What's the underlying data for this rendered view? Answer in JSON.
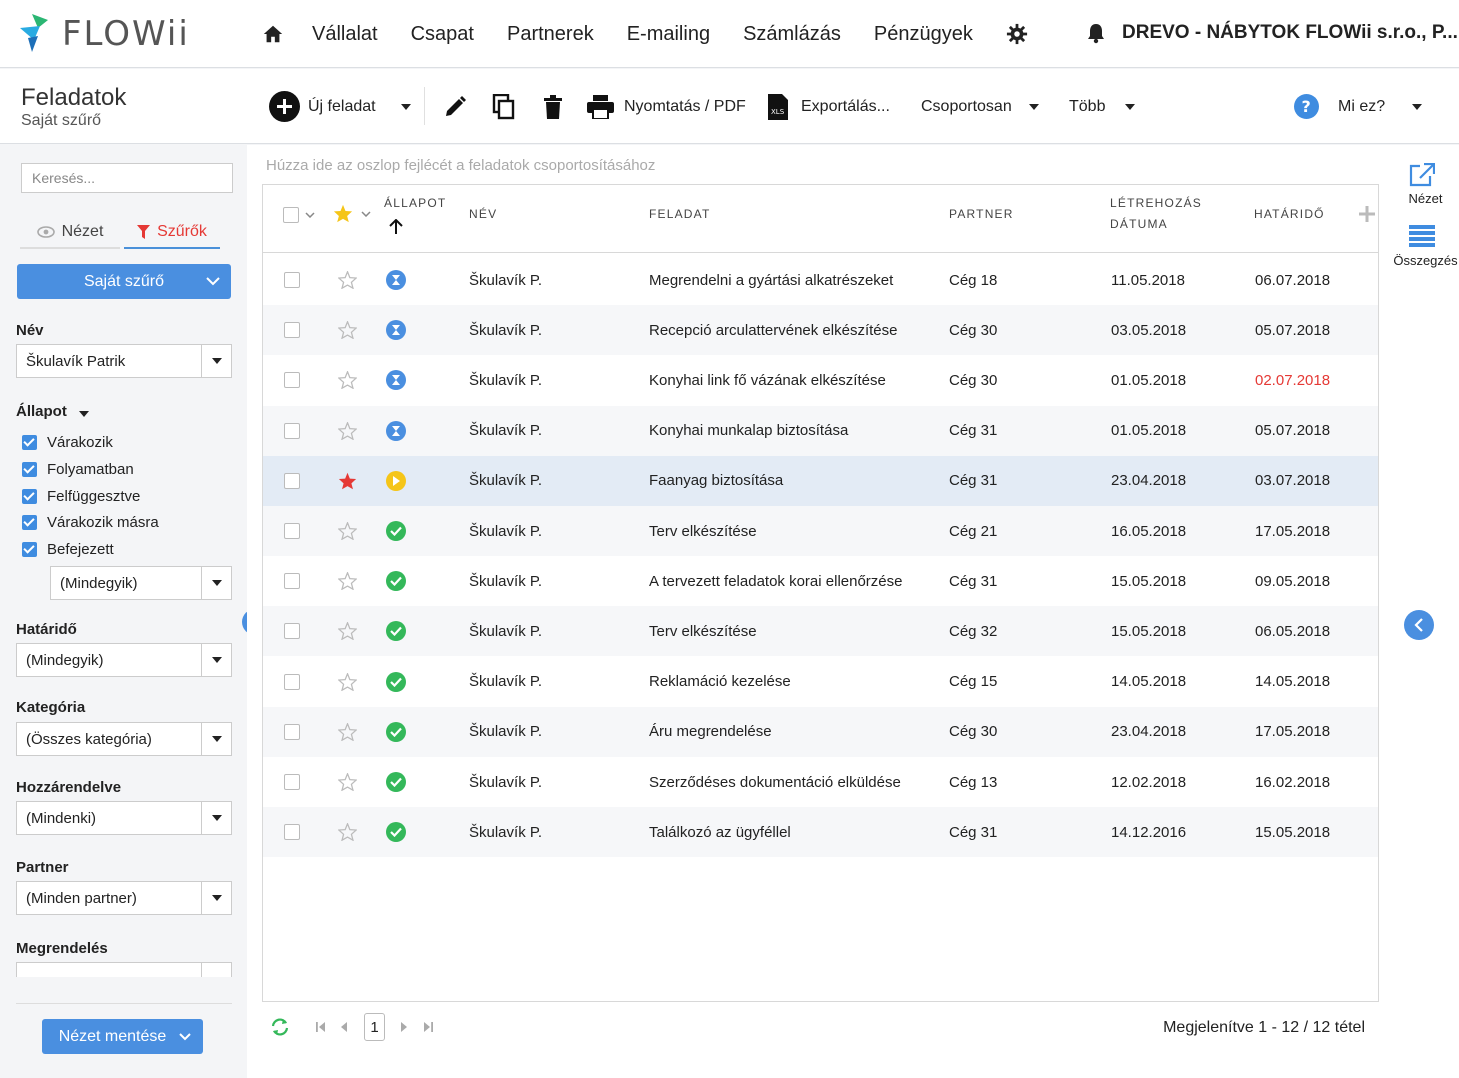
{
  "brand": {
    "logo_text": "FLOWii"
  },
  "nav": {
    "items": [
      "Vállalat",
      "Csapat",
      "Partnerek",
      "E-mailing",
      "Számlázás",
      "Pénzügyek"
    ],
    "company": "DREVO - NÁBYTOK FLOWii s.r.o., P..."
  },
  "toolbar": {
    "title": "Feladatok",
    "subtitle": "Saját szűrő",
    "new_task": "Új feladat",
    "print": "Nyomtatás / PDF",
    "export": "Exportálás...",
    "bulk": "Csoportosan",
    "more": "Több",
    "help": "Mi ez?"
  },
  "sidebar": {
    "search_placeholder": "Keresés...",
    "tab_view": "Nézet",
    "tab_filters": "Szűrők",
    "filter_button": "Saját szűrő",
    "name_label": "Név",
    "name_value": "Škulavík Patrik",
    "state_label": "Állapot",
    "states": [
      "Várakozik",
      "Folyamatban",
      "Felfüggesztve",
      "Várakozik másra",
      "Befejezett"
    ],
    "state_select": "(Mindegyik)",
    "deadline_label": "Határidő",
    "deadline_value": "(Mindegyik)",
    "category_label": "Kategória",
    "category_value": "(Összes kategória)",
    "assigned_label": "Hozzárendelve",
    "assigned_value": "(Mindenki)",
    "partner_label": "Partner",
    "partner_value": "(Minden partner)",
    "order_label": "Megrendelés",
    "save_view": "Nézet mentése"
  },
  "grid": {
    "group_hint": "Húzza ide az oszlop fejlécét a feladatok csoportosításához",
    "columns": {
      "state": "Állapot",
      "name": "Név",
      "task": "Feladat",
      "partner": "Partner",
      "created_1": "Létrehozás",
      "created_2": "dátuma",
      "deadline": "Határidő"
    },
    "rows": [
      {
        "starred": false,
        "status": "wait",
        "name": "Škulavík P.",
        "task": "Megrendelni a gyártási alkatrészeket",
        "partner": "Cég 18",
        "created": "11.05.2018",
        "deadline": "06.07.2018",
        "overdue": false
      },
      {
        "starred": false,
        "status": "wait",
        "name": "Škulavík P.",
        "task": "Recepció arculattervének elkészítése",
        "partner": "Cég 30",
        "created": "03.05.2018",
        "deadline": "05.07.2018",
        "overdue": false
      },
      {
        "starred": false,
        "status": "wait",
        "name": "Škulavík P.",
        "task": "Konyhai link fő vázának elkészítése",
        "partner": "Cég 30",
        "created": "01.05.2018",
        "deadline": "02.07.2018",
        "overdue": true
      },
      {
        "starred": false,
        "status": "wait",
        "name": "Škulavík P.",
        "task": "Konyhai munkalap biztosítása",
        "partner": "Cég 31",
        "created": "01.05.2018",
        "deadline": "05.07.2018",
        "overdue": false
      },
      {
        "starred": true,
        "status": "prog",
        "name": "Škulavík P.",
        "task": "Faanyag biztosítása",
        "partner": "Cég 31",
        "created": "23.04.2018",
        "deadline": "03.07.2018",
        "overdue": false
      },
      {
        "starred": false,
        "status": "done",
        "name": "Škulavík P.",
        "task": "Terv elkészítése",
        "partner": "Cég 21",
        "created": "16.05.2018",
        "deadline": "17.05.2018",
        "overdue": false
      },
      {
        "starred": false,
        "status": "done",
        "name": "Škulavík P.",
        "task": "A tervezett feladatok korai ellenőrzése",
        "partner": "Cég 31",
        "created": "15.05.2018",
        "deadline": "09.05.2018",
        "overdue": false
      },
      {
        "starred": false,
        "status": "done",
        "name": "Škulavík P.",
        "task": "Terv elkészítése",
        "partner": "Cég 32",
        "created": "15.05.2018",
        "deadline": "06.05.2018",
        "overdue": false
      },
      {
        "starred": false,
        "status": "done",
        "name": "Škulavík P.",
        "task": "Reklamáció kezelése",
        "partner": "Cég 15",
        "created": "14.05.2018",
        "deadline": "14.05.2018",
        "overdue": false
      },
      {
        "starred": false,
        "status": "done",
        "name": "Škulavík P.",
        "task": "Áru megrendelése",
        "partner": "Cég 30",
        "created": "23.04.2018",
        "deadline": "17.05.2018",
        "overdue": false
      },
      {
        "starred": false,
        "status": "done",
        "name": "Škulavík P.",
        "task": "Szerződéses dokumentáció elküldése",
        "partner": "Cég 13",
        "created": "12.02.2018",
        "deadline": "16.02.2018",
        "overdue": false
      },
      {
        "starred": false,
        "status": "done",
        "name": "Škulavík P.",
        "task": "Találkozó az ügyféllel",
        "partner": "Cég 31",
        "created": "14.12.2016",
        "deadline": "15.05.2018",
        "overdue": false
      }
    ],
    "page": "1",
    "summary": "Megjelenítve 1 - 12 / 12 tétel"
  },
  "rail": {
    "view_label": "Nézet",
    "summary_label": "Összegzés"
  },
  "colors": {
    "accent": "#4a8fe0",
    "danger": "#e53935",
    "success": "#34b85a",
    "warning": "#f5c518",
    "highlight_row": "#e3ebf5"
  }
}
